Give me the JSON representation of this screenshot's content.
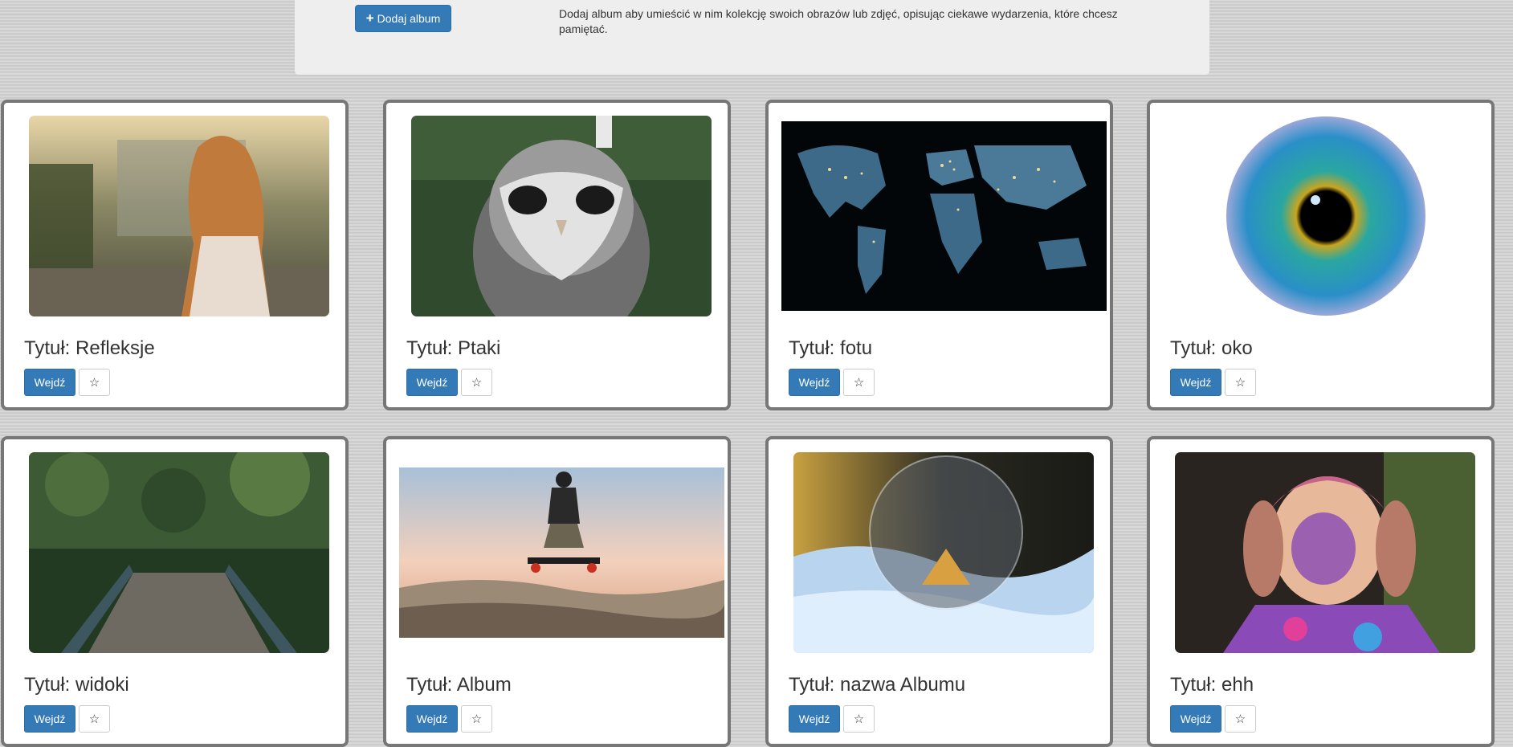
{
  "header": {
    "add_album_label": "Dodaj album",
    "add_album_icon": "plus-icon",
    "description": "Dodaj album aby umieścić w nim kolekcję swoich obrazów lub zdjęć, opisując ciekawe wydarzenia, które chcesz pamiętać."
  },
  "albums": [
    {
      "title": "Tytuł: Refleksje",
      "enter_label": "Wejdź",
      "favorite_icon": "star-icon",
      "image": "woman-by-greenhouse"
    },
    {
      "title": "Tytuł: Ptaki",
      "enter_label": "Wejdź",
      "favorite_icon": "star-icon",
      "image": "owl"
    },
    {
      "title": "Tytuł: fotu",
      "enter_label": "Wejdź",
      "favorite_icon": "star-icon",
      "image": "world-map-at-night"
    },
    {
      "title": "Tytuł: oko",
      "enter_label": "Wejdź",
      "favorite_icon": "star-icon",
      "image": "blue-eye-iris"
    },
    {
      "title": "Tytuł: widoki",
      "enter_label": "Wejdź",
      "favorite_icon": "star-icon",
      "image": "forest-bridge"
    },
    {
      "title": "Tytuł: Album",
      "enter_label": "Wejdź",
      "favorite_icon": "star-icon",
      "image": "mountainboard-jumper"
    },
    {
      "title": "Tytuł: nazwa Albumu",
      "enter_label": "Wejdź",
      "favorite_icon": "star-icon",
      "image": "frozen-bubble-in-snow"
    },
    {
      "title": "Tytuł: ehh",
      "enter_label": "Wejdź",
      "favorite_icon": "star-icon",
      "image": "girl-covered-in-holi-paint"
    }
  ],
  "colors": {
    "primary": "#337ab7",
    "card_border": "#777777",
    "panel": "#eeeeee"
  }
}
